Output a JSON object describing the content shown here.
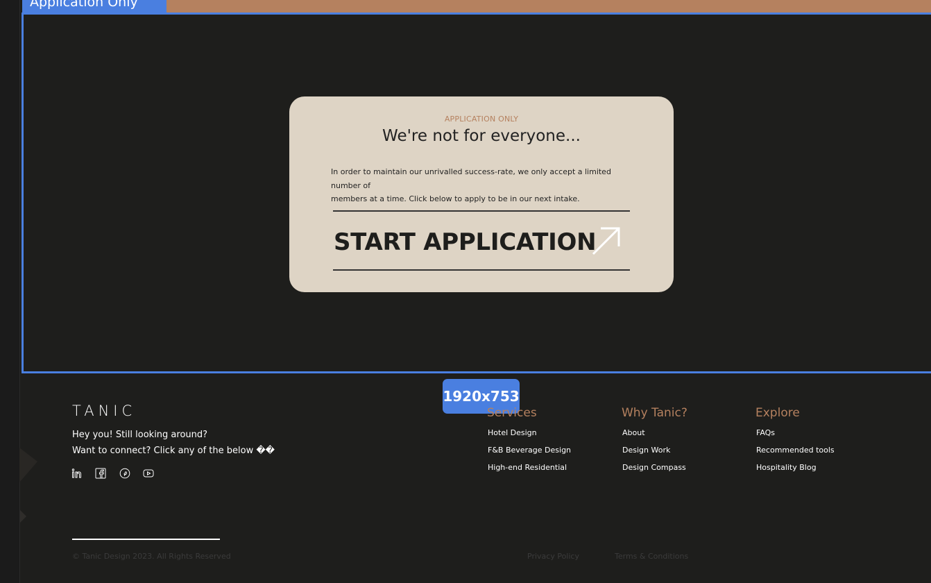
{
  "frame": {
    "tag": "Application Only",
    "size_badge": "1920x753"
  },
  "card": {
    "eyebrow": "APPLICATION ONLY",
    "headline": "We're not for everyone...",
    "body_line1": "In order to maintain our unrivalled success-rate, we only accept a limited number of",
    "body_line2": "members at a time. Click below to apply to be in our next intake.",
    "cta_label": "START APPLICATION",
    "cta_icon": "arrow-up-right-icon"
  },
  "footer": {
    "logo": "TANIC",
    "tagline1": "Hey you! Still looking around?",
    "tagline2": "Want to connect? Click any of the below ��",
    "social_icons": [
      "linkedin-icon",
      "facebook-icon",
      "pinterest-icon",
      "youtube-icon"
    ],
    "columns": [
      {
        "title": "Services",
        "links": [
          "Hotel Design",
          "F&B Beverage Design",
          "High-end Residential"
        ]
      },
      {
        "title": "Why Tanic?",
        "links": [
          "About",
          "Design Work",
          "Design Compass"
        ]
      },
      {
        "title": "Explore",
        "links": [
          "FAQs",
          "Recommended tools",
          "Hospitality Blog"
        ]
      }
    ],
    "copyright": "© Tanic Design 2023. All Rights Reserved",
    "privacy": "Privacy Policy",
    "terms": "Terms & Conditions"
  },
  "colors": {
    "accent": "#b5815f",
    "card_bg": "#ded4c5",
    "page_bg": "#1e1e1c",
    "selection": "#4a7fe0"
  }
}
